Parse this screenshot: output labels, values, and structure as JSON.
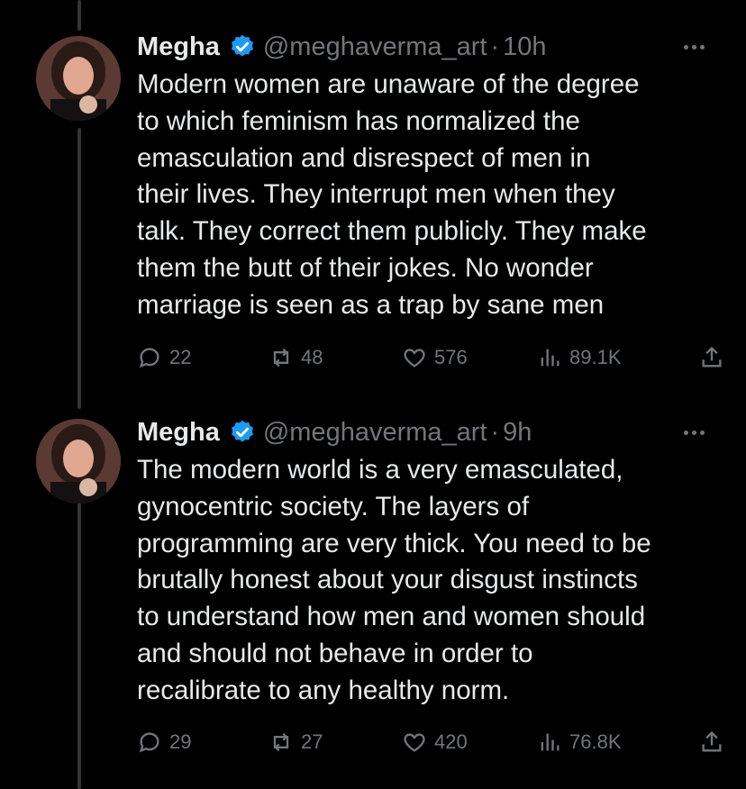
{
  "tweets": [
    {
      "name": "Megha",
      "handle": "@meghaverma_art",
      "separator": "·",
      "time": "10h",
      "text": "Modern women are unaware of the degree\nto which feminism has normalized the\nemasculation and disrespect of men in\ntheir lives. They interrupt men when they\ntalk. They correct them publicly. They make\nthem the butt of their jokes. No wonder\nmarriage is seen as a trap by sane men",
      "replies": "22",
      "reposts": "48",
      "likes": "576",
      "views": "89.1K"
    },
    {
      "name": "Megha",
      "handle": "@meghaverma_art",
      "separator": "·",
      "time": "9h",
      "text": "The modern world is a very emasculated,\ngynocentric society. The layers of\nprogramming are very thick. You need to be\nbrutally honest about your disgust instincts\nto understand how men and women should\nand should not behave in order to\nrecalibrate to any healthy norm.",
      "replies": "29",
      "reposts": "27",
      "likes": "420",
      "views": "76.8K"
    }
  ],
  "icons": {
    "verified": "verified-badge-icon",
    "more": "more-icon",
    "reply": "reply-icon",
    "repost": "repost-icon",
    "like": "heart-icon",
    "views": "views-icon",
    "share": "share-icon"
  },
  "colors": {
    "background": "#000000",
    "text": "#e7e9ea",
    "muted": "#71767b",
    "verified": "#1d9bf0",
    "thread_line": "#333639"
  }
}
